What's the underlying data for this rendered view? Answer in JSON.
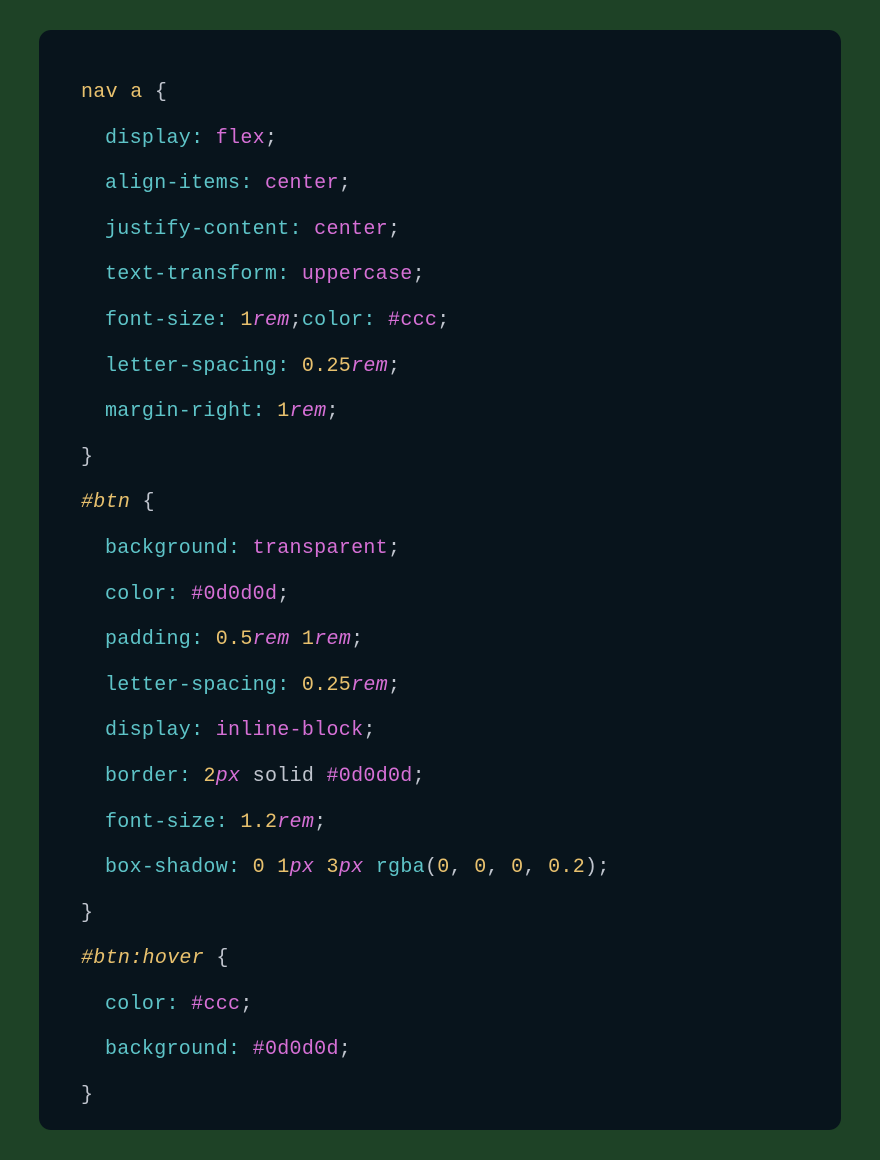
{
  "code": {
    "sel1": "nav a",
    "rule1": {
      "p1": "display",
      "v1": "flex",
      "p2": "align-items",
      "v2": "center",
      "p3": "justify-content",
      "v3": "center",
      "p4": "text-transform",
      "v4": "uppercase",
      "p5": "font-size",
      "n5": "1",
      "u5": "rem",
      "p5b": "color",
      "v5b": "#ccc",
      "p6": "letter-spacing",
      "n6": "0.25",
      "u6": "rem",
      "p7": "margin-right",
      "n7": "1",
      "u7": "rem"
    },
    "sel2": "#btn",
    "rule2": {
      "p1": "background",
      "v1": "transparent",
      "p2": "color",
      "v2": "#0d0d0d",
      "p3": "padding",
      "n3a": "0.5",
      "u3a": "rem",
      "n3b": "1",
      "u3b": "rem",
      "p4": "letter-spacing",
      "n4": "0.25",
      "u4": "rem",
      "p5": "display",
      "v5": "inline-block",
      "p6": "border",
      "n6": "2",
      "u6": "px",
      "v6a": "solid",
      "v6b": "#0d0d0d",
      "p7": "font-size",
      "n7": "1.2",
      "u7": "rem",
      "p8": "box-shadow",
      "n8a": "0",
      "n8b": "1",
      "u8b": "px",
      "n8c": "3",
      "u8c": "px",
      "fn8": "rgba",
      "arg8a": "0",
      "arg8b": "0",
      "arg8c": "0",
      "arg8d": "0.2"
    },
    "sel3a": "#btn",
    "sel3b": ":hover",
    "rule3": {
      "p1": "color",
      "v1": "#ccc",
      "p2": "background",
      "v2": "#0d0d0d"
    }
  }
}
